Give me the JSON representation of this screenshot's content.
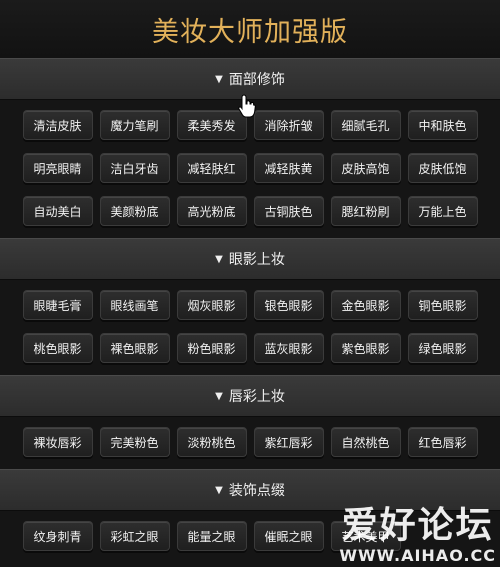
{
  "title": "美妆大师加强版",
  "arrow_glyph": "▼",
  "sections": [
    {
      "name": "面部修饰",
      "buttons": [
        "清洁皮肤",
        "魔力笔刷",
        "柔美秀发",
        "消除折皱",
        "细腻毛孔",
        "中和肤色",
        "明亮眼睛",
        "洁白牙齿",
        "减轻肤红",
        "减轻肤黄",
        "皮肤高饱",
        "皮肤低饱",
        "自动美白",
        "美颜粉底",
        "高光粉底",
        "古铜肤色",
        "腮红粉刷",
        "万能上色"
      ]
    },
    {
      "name": "眼影上妆",
      "buttons": [
        "眼睫毛膏",
        "眼线画笔",
        "烟灰眼影",
        "银色眼影",
        "金色眼影",
        "铜色眼影",
        "桃色眼影",
        "裸色眼影",
        "粉色眼影",
        "蓝灰眼影",
        "紫色眼影",
        "绿色眼影"
      ]
    },
    {
      "name": "唇彩上妆",
      "buttons": [
        "裸妆唇彩",
        "完美粉色",
        "淡粉桃色",
        "紫红唇彩",
        "自然桃色",
        "红色唇彩"
      ]
    },
    {
      "name": "装饰点缀",
      "buttons": [
        "纹身刺青",
        "彩虹之眼",
        "能量之眼",
        "催眠之眼",
        "艺术美甲"
      ]
    }
  ],
  "watermark": {
    "main": "爱好论坛",
    "sub": "WWW.AIHAO.CC"
  },
  "cursor_icon": "hand-pointer-icon"
}
